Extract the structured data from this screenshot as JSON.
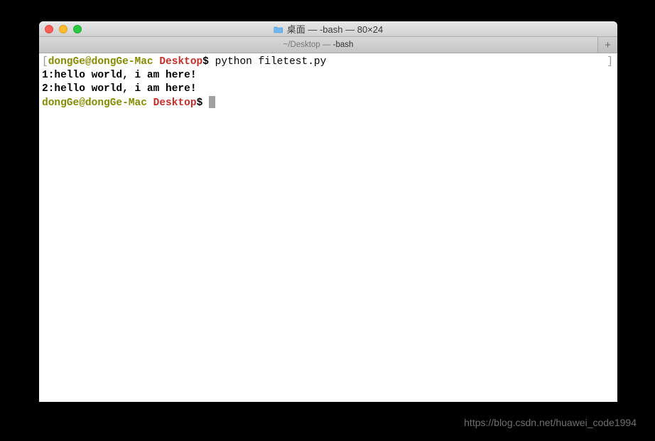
{
  "window": {
    "title": "桌面 — -bash — 80×24"
  },
  "tab": {
    "path": "~/Desktop — ",
    "process": "-bash"
  },
  "prompt": {
    "open_bracket": "[",
    "close_bracket": "]",
    "user_host": "dongGe@dongGe-Mac",
    "cwd": "Desktop",
    "symbol": "$"
  },
  "terminal": {
    "command": "python filetest.py",
    "output_lines": [
      "1:hello world, i am here!",
      "",
      "2:hello world, i am here!",
      ""
    ]
  },
  "watermark": "https://blog.csdn.net/huawei_code1994"
}
